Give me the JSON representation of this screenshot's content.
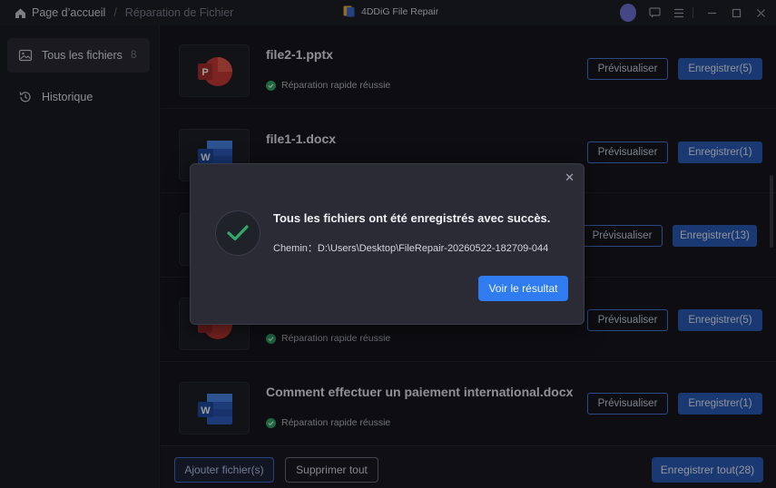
{
  "titlebar": {
    "home_label": "Page d’accueil",
    "separator": "/",
    "current": "Réparation de Fichier",
    "app_name": "4DDiG File Repair"
  },
  "sidebar": {
    "items": [
      {
        "label": "Tous les fichiers",
        "count": "8",
        "icon": "image-files-icon"
      },
      {
        "label": "Historique",
        "icon": "history-icon"
      }
    ]
  },
  "files": [
    {
      "name": "file2-1.pptx",
      "type": "pptx",
      "status": "Réparation rapide réussie",
      "preview_label": "Prévisualiser",
      "save_label": "Enregistrer(5)"
    },
    {
      "name": "file1-1.docx",
      "type": "docx",
      "status": "",
      "preview_label": "Prévisualiser",
      "save_label": "Enregistrer(1)"
    },
    {
      "name": "",
      "type": "pptx",
      "status": "",
      "preview_label": "Prévisualiser",
      "save_label": "Enregistrer(13)"
    },
    {
      "name": "",
      "type": "pptx",
      "status": "Réparation rapide réussie",
      "preview_label": "Prévisualiser",
      "save_label": "Enregistrer(5)"
    },
    {
      "name": "Comment effectuer un paiement international.docx",
      "type": "docx",
      "status": "Réparation rapide réussie",
      "preview_label": "Prévisualiser",
      "save_label": "Enregistrer(1)"
    }
  ],
  "footer": {
    "add_label": "Ajouter fichier(s)",
    "delete_label": "Supprimer tout",
    "save_all_label": "Enregistrer tout(28)"
  },
  "dialog": {
    "title": "Tous les fichiers ont été enregistrés avec succès.",
    "path": "Chemin：D:\\Users\\Desktop\\FileRepair-20260522-182709-044",
    "button_label": "Voir le résultat",
    "close": "✕"
  },
  "colors": {
    "accent": "#2f7cf0",
    "success": "#2faa6a",
    "ppt": "#c83a36",
    "word": "#2f5ec4"
  }
}
